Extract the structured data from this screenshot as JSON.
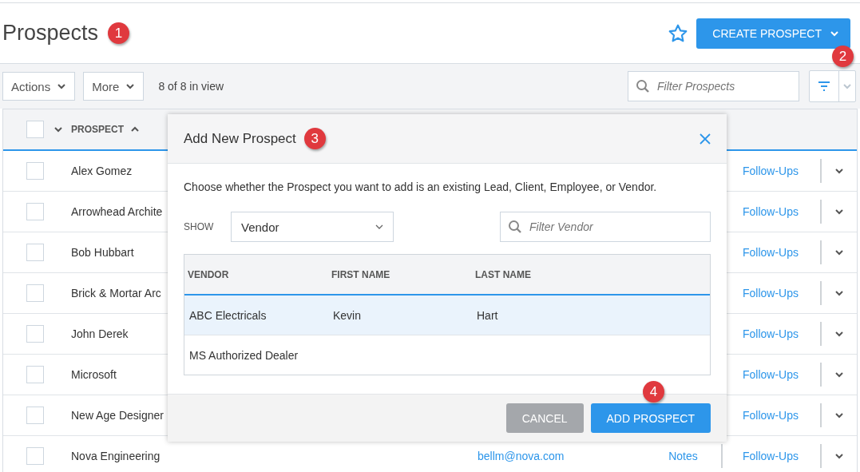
{
  "header": {
    "title": "Prospects",
    "favorite": false,
    "create_button": "CREATE PROSPECT"
  },
  "toolbar": {
    "actions": "Actions",
    "more": "More",
    "count": "8 of 8 in view",
    "filter": {
      "placeholder": "Filter Prospects"
    }
  },
  "table": {
    "select_all": {
      "checked": false
    },
    "columns": [
      {
        "label": "PROSPECT",
        "sorted_ascending": true
      }
    ],
    "rows": [
      {
        "name": "Alex Gomez",
        "checked": false,
        "followups": "Follow-Ups"
      },
      {
        "name": "Arrowhead Archite",
        "checked": false,
        "followups": "Follow-Ups"
      },
      {
        "name": "Bob Hubbart",
        "checked": false,
        "followups": "Follow-Ups"
      },
      {
        "name": "Brick & Mortar Arc",
        "checked": false,
        "followups": "Follow-Ups"
      },
      {
        "name": "John Derek",
        "checked": false,
        "followups": "Follow-Ups"
      },
      {
        "name": "Microsoft",
        "checked": false,
        "followups": "Follow-Ups"
      },
      {
        "name": "New Age Designer",
        "checked": false,
        "followups": "Follow-Ups"
      },
      {
        "name": "Nova Engineering",
        "checked": false,
        "email": "bellm@nova.com",
        "notes": "Notes",
        "followups": "Follow-Ups"
      }
    ]
  },
  "dialog": {
    "title": "Add New Prospect",
    "description": "Choose whether the Prospect you want to add is an existing Lead, Client, Employee, or Vendor.",
    "show_label": "SHOW",
    "show_value": "Vendor",
    "filter": {
      "placeholder": "Filter Vendor"
    },
    "columns": [
      "VENDOR",
      "FIRST NAME",
      "LAST NAME"
    ],
    "rows": [
      {
        "cells": [
          "ABC Electricals",
          "Kevin",
          "Hart"
        ],
        "selected": true
      },
      {
        "cells": [
          "MS Authorized Dealer",
          "",
          ""
        ],
        "selected": false
      }
    ],
    "buttons": [
      {
        "label": "CANCEL",
        "kind": "secondary"
      },
      {
        "label": "ADD PROSPECT",
        "kind": "primary"
      }
    ]
  },
  "callouts": [
    "1",
    "2",
    "3",
    "4"
  ]
}
